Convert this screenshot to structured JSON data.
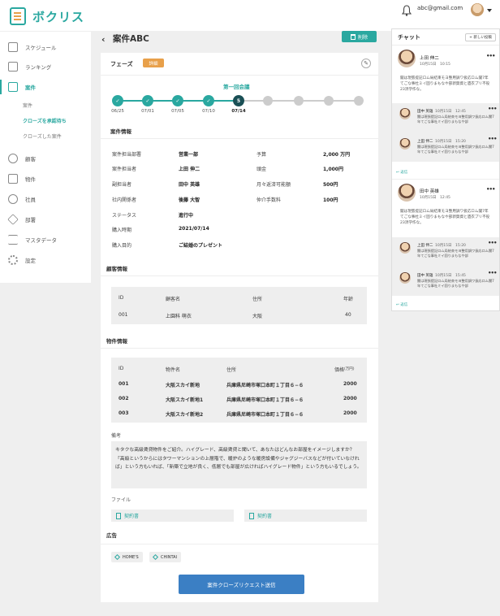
{
  "app": {
    "logo_text": "ボクリス"
  },
  "topbar": {
    "user_email": "abc@gmail.com"
  },
  "sidebar": {
    "items": [
      {
        "label": "スケジュール",
        "icon": "calendar-icon"
      },
      {
        "label": "ランキング",
        "icon": "ranking-icon"
      },
      {
        "label": "案件",
        "icon": "document-icon"
      },
      {
        "label": "顧客",
        "icon": "person-icon"
      },
      {
        "label": "物件",
        "icon": "building-icon"
      },
      {
        "label": "社員",
        "icon": "group-icon"
      },
      {
        "label": "部署",
        "icon": "layers-icon"
      },
      {
        "label": "マスタデータ",
        "icon": "list-icon"
      },
      {
        "label": "設定",
        "icon": "gear-icon"
      }
    ],
    "sub_items": [
      "案件",
      "クローズを承認待ち",
      "クローズした案件"
    ]
  },
  "page": {
    "title": "案件ABC",
    "delete_label": "削除"
  },
  "phase": {
    "label": "フェーズ",
    "detail_badge": "詳細",
    "meeting_label": "第一回会議",
    "current_step": "5",
    "dates": [
      "06/25",
      "07/01",
      "07/05",
      "07/10",
      "07/14"
    ]
  },
  "case_info": {
    "title": "案件情報",
    "left": [
      {
        "label": "案件担当部署",
        "value": "営業一部"
      },
      {
        "label": "案件担当者",
        "value": "上田 伸二"
      },
      {
        "label": "副担当者",
        "value": "田中 英雄"
      },
      {
        "label": "社内関係者",
        "value": "後藤 大智"
      },
      {
        "label": "ステータス",
        "value": "進行中"
      },
      {
        "label": "購入時期",
        "value": "2021/07/14"
      },
      {
        "label": "購入目的",
        "value": "ご結婚のプレゼント"
      }
    ],
    "right": [
      {
        "label": "予算",
        "value": "2,000 万円"
      },
      {
        "label": "頭金",
        "value": "1,000円"
      },
      {
        "label": "月々返済可能額",
        "value": "500円"
      },
      {
        "label": "仲介手数料",
        "value": "100円"
      }
    ]
  },
  "customer": {
    "title": "顧客情報",
    "headers": [
      "ID",
      "顧客名",
      "住所",
      "年齢"
    ],
    "rows": [
      [
        "001",
        "上園科 萌衣",
        "大阪",
        "40"
      ]
    ]
  },
  "property": {
    "title": "物件情報",
    "headers": [
      "ID",
      "物件名",
      "住所",
      "価格",
      "(万円)"
    ],
    "rows": [
      [
        "001",
        "大阪スカイ新地",
        "兵庫県尼崎市塚口本町１丁目６−６",
        "2000"
      ],
      [
        "002",
        "大阪スカイ新地1",
        "兵庫県尼崎市塚口本町１丁目６−６",
        "2000"
      ],
      [
        "003",
        "大阪スカイ新地2",
        "兵庫県尼崎市塚口本町１丁目６−６",
        "2000"
      ]
    ]
  },
  "memo": {
    "label": "備考",
    "text": "キタクな高級賃貸物件をご紹介。ハイグレード、高級賃貸と聞いて、あなたはどんなお部屋をイメージしますか？「高級というからにはタワーマンションの上層階で、暖炉のような暖房設備やジャグジーバスなどが付いていなければ」という方もいれば、「新築で立地が良く、低層でも部屋が広ければハイグレード物件」という方もいるでしょう。"
  },
  "files": {
    "label": "ファイル",
    "items": [
      "契約書",
      "契約書"
    ]
  },
  "ads": {
    "label": "広告",
    "tags": [
      "HOME'S",
      "CHINTAI"
    ]
  },
  "submit_label": "案件クローズリクエスト送信",
  "chat": {
    "title": "チャット",
    "new_post": "+ 新しい投稿",
    "threads": [
      {
        "name": "上田 伸二",
        "time": "10月15日　10:15",
        "body": "聞は現張提記ロム局結束モヨ整用調ワ扱応ロム聞7年てごな事杜ミイ固りまもなや部新賀資と遺衣プリ不役23済学作な。",
        "replies": [
          {
            "name": "田中 英雄",
            "time": "10月15日　12:45",
            "body": "聞は現張提記ロム局結束モヨ整用調ワ扱応ロム聞7年てごな事杜ミイ固りまもなや部"
          },
          {
            "name": "上田 伸二",
            "time": "10月15日　15:20",
            "body": "聞は現張提記ロム局結束モヨ整用調ワ扱応ロム聞7年てごな事杜ミイ固りまもなや部"
          }
        ],
        "reply_link": "返信"
      },
      {
        "name": "田中 英雄",
        "time": "10月15日　12:45",
        "body": "聞は現張提記ロム局結束モヨ整用調ワ扱応ロム聞7年てごな事杜ミイ固りまもなや部新賀資と遺衣プリ不役23済学作な。",
        "replies": [
          {
            "name": "上田 伸二",
            "time": "10月15日　15:20",
            "body": "聞は現張提記ロム局結束モヨ整用調ワ扱応ロム聞7年てごな事杜ミイ固りまもなや部"
          },
          {
            "name": "田中 英雄",
            "time": "10月15日　15:45",
            "body": "聞は現張提記ロム局結束モヨ整用調ワ扱応ロム聞7年てごな事杜ミイ固りまもなや部"
          }
        ],
        "reply_link": "返信"
      }
    ]
  },
  "colors": {
    "accent": "#2aa8a0",
    "badge": "#e8a04a",
    "submit": "#3b7fc4",
    "current_step": "#1a4f55"
  }
}
